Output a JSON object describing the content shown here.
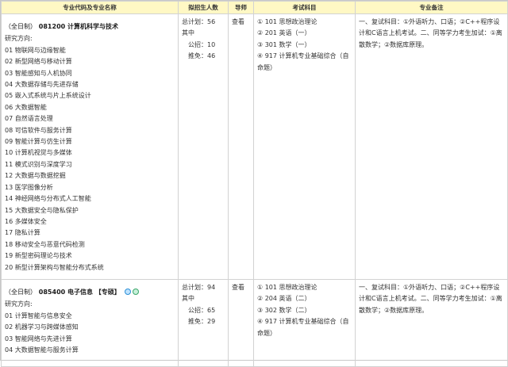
{
  "header": {
    "col1": "专业代码及专业名称",
    "col2": "拟招生人数",
    "col3": "导师",
    "col4": "考试科目",
    "col5": "专业备注"
  },
  "majors": [
    {
      "format": "（全日制）",
      "code_name": "081200 计算机科学与技术",
      "tag": "",
      "dirs_label": "研究方向:",
      "dirs": [
        "01 物联网与边缘智能",
        "02 新型网络与移动计算",
        "03 智能感知与人机协同",
        "04 大数据存储与先进存储",
        "05 嵌入式系统与片上系统设计",
        "06 大数据智能",
        "07 自然语言处理",
        "08 可信软件与服务计算",
        "09 智能计算与仿生计算",
        "10 计算机视觉与多媒体",
        "11 模式识别与深度学习",
        "12 大数据与数据挖掘",
        "13 医学图像分析",
        "14 神经网络与分布式人工智能",
        "15 大数据安全与隐私保护",
        "16 多媒体安全",
        "17 隐私计算",
        "18 移动安全与恶意代码检测",
        "19 新型密码理论与技术",
        "20 新型计算架构与智能分布式系统"
      ],
      "plan": [
        "总计划：56",
        "其中",
        "公招：10",
        "推免：46"
      ],
      "tutor": "查看",
      "subjects": [
        "① 101 思想政治理论",
        "② 201 英语（一）",
        "③ 301 数学（一）",
        "④ 917 计算机专业基础综合（自命题）"
      ],
      "note": "一、复试科目：①外语听力、口语；②C++程序设计和C语言上机考试。二、同等学力考生加试：①离散数学；②数据库原理。"
    },
    {
      "format": "（全日制）",
      "code_name": "085400 电子信息",
      "tag": "【专硕】",
      "dirs_label": "研究方向:",
      "dirs": [
        "01 计算智能与信息安全",
        "02 机器学习与跨媒体感知",
        "03 智能网络与先进计算",
        "04 大数据智能与服务计算"
      ],
      "plan": [
        "总计划：94",
        "其中",
        "公招：65",
        "推免：29"
      ],
      "tutor": "查看",
      "subjects": [
        "① 101 思想政治理论",
        "② 204 英语（二）",
        "③ 302 数学（二）",
        "④ 917 计算机专业基础综合（自命题）"
      ],
      "note": "一、复试科目：①外语听力、口语；②C++程序设计和C语言上机考试。二、同等学力考生加试：①离散数学；②数据库原理。"
    }
  ],
  "icons": [
    "qa-icon-blue",
    "qa-icon-green"
  ],
  "colors": {
    "header_bg": "#fff8c4",
    "border": "#d2d2d2"
  }
}
